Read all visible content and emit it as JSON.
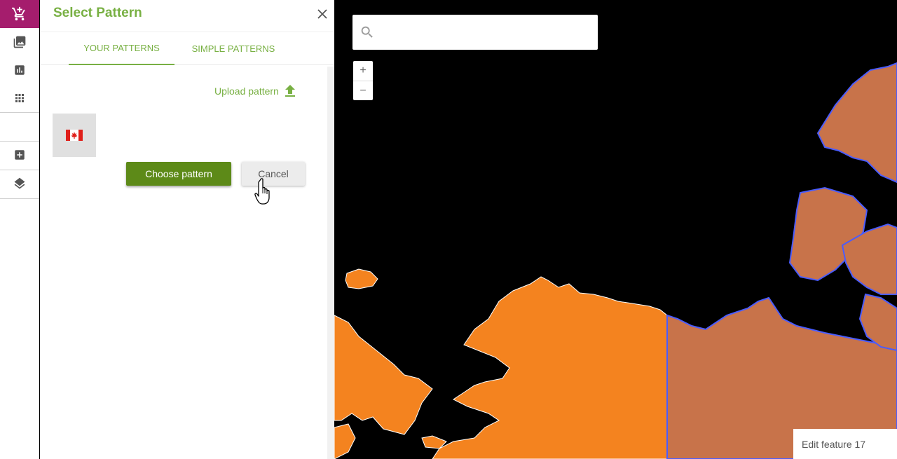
{
  "rail": {
    "items": [
      {
        "icon": "cart-add-icon",
        "active": true
      },
      {
        "icon": "image-icon"
      },
      {
        "icon": "chart-icon"
      },
      {
        "icon": "grid-icon"
      },
      {
        "icon": "add-box-icon"
      },
      {
        "icon": "layers-icon"
      }
    ]
  },
  "panel": {
    "title": "Select Pattern",
    "tabs": [
      {
        "label": "YOUR PATTERNS",
        "active": true
      },
      {
        "label": "SIMPLE PATTERNS",
        "active": false
      }
    ],
    "upload_label": "Upload pattern",
    "pattern_icon": "canada-flag-icon",
    "choose_label": "Choose pattern",
    "cancel_label": "Cancel"
  },
  "map": {
    "search_placeholder": "",
    "zoom_in": "+",
    "zoom_out": "−",
    "status_text": "Edit feature 17"
  },
  "colors": {
    "accent_green": "#78b043",
    "button_green": "#5d8a18",
    "rail_active": "#a51d6d",
    "land_orange": "#f4831f",
    "land_brown": "#c8734a",
    "outline_blue": "#4a5cff"
  }
}
